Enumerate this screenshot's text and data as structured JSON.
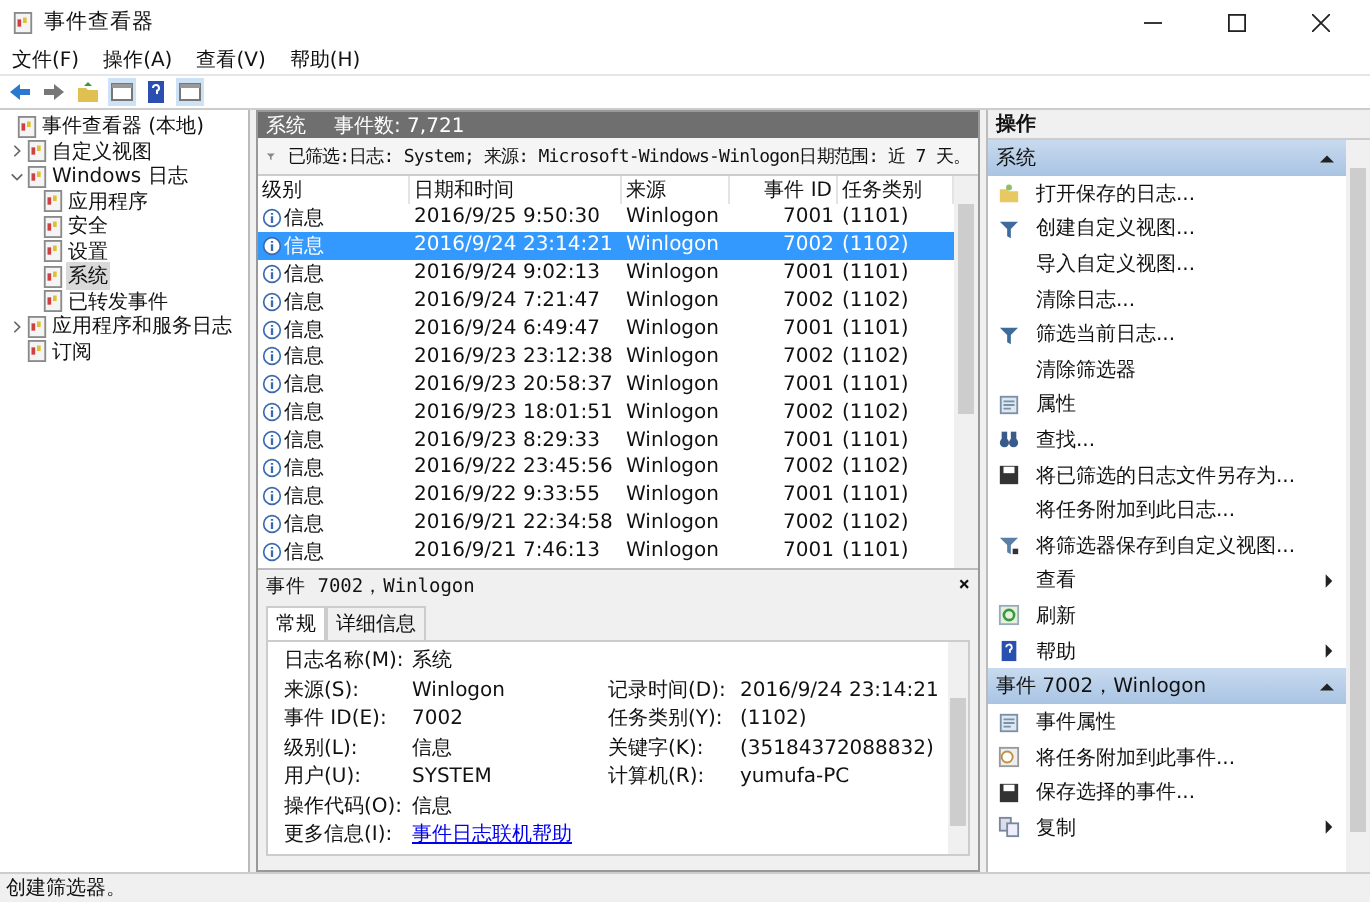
{
  "window": {
    "title": "事件查看器"
  },
  "menu": [
    "文件(F)",
    "操作(A)",
    "查看(V)",
    "帮助(H)"
  ],
  "tree": [
    {
      "label": "事件查看器 (本地)",
      "children": [
        {
          "label": "自定义视图",
          "expanded": false,
          "selected": false
        },
        {
          "label": "Windows 日志",
          "expanded": true,
          "selected": false,
          "children": [
            {
              "label": "应用程序",
              "selected": false
            },
            {
              "label": "安全",
              "selected": false
            },
            {
              "label": "设置",
              "selected": false
            },
            {
              "label": "系统",
              "selected": true
            },
            {
              "label": "已转发事件",
              "selected": false
            }
          ]
        },
        {
          "label": "应用程序和服务日志",
          "expanded": false,
          "selected": false
        },
        {
          "label": "订阅",
          "selected": false
        }
      ],
      "selected": false
    }
  ],
  "log_header": {
    "name": "系统",
    "count": "事件数: 7,721"
  },
  "filter": "已筛选:日志: System; 来源: Microsoft-Windows-Winlogon日期范围: 近 7 天。",
  "table": {
    "columns": [
      "级别",
      "日期和时间",
      "来源",
      "事件 ID",
      "任务类别"
    ],
    "rows": [
      {
        "level": "信息",
        "date": "2016/9/25 9:50:30",
        "source": "Winlogon",
        "id": "7001",
        "task": "(1101)",
        "selected": false
      },
      {
        "level": "信息",
        "date": "2016/9/24 23:14:21",
        "source": "Winlogon",
        "id": "7002",
        "task": "(1102)",
        "selected": true
      },
      {
        "level": "信息",
        "date": "2016/9/24 9:02:13",
        "source": "Winlogon",
        "id": "7001",
        "task": "(1101)",
        "selected": false
      },
      {
        "level": "信息",
        "date": "2016/9/24 7:21:47",
        "source": "Winlogon",
        "id": "7002",
        "task": "(1102)",
        "selected": false
      },
      {
        "level": "信息",
        "date": "2016/9/24 6:49:47",
        "source": "Winlogon",
        "id": "7001",
        "task": "(1101)",
        "selected": false
      },
      {
        "level": "信息",
        "date": "2016/9/23 23:12:38",
        "source": "Winlogon",
        "id": "7002",
        "task": "(1102)",
        "selected": false
      },
      {
        "level": "信息",
        "date": "2016/9/23 20:58:37",
        "source": "Winlogon",
        "id": "7001",
        "task": "(1101)",
        "selected": false
      },
      {
        "level": "信息",
        "date": "2016/9/23 18:01:51",
        "source": "Winlogon",
        "id": "7002",
        "task": "(1102)",
        "selected": false
      },
      {
        "level": "信息",
        "date": "2016/9/23 8:29:33",
        "source": "Winlogon",
        "id": "7001",
        "task": "(1101)",
        "selected": false
      },
      {
        "level": "信息",
        "date": "2016/9/22 23:45:56",
        "source": "Winlogon",
        "id": "7002",
        "task": "(1102)",
        "selected": false
      },
      {
        "level": "信息",
        "date": "2016/9/22 9:33:55",
        "source": "Winlogon",
        "id": "7001",
        "task": "(1101)",
        "selected": false
      },
      {
        "level": "信息",
        "date": "2016/9/21 22:34:58",
        "source": "Winlogon",
        "id": "7002",
        "task": "(1102)",
        "selected": false
      },
      {
        "level": "信息",
        "date": "2016/9/21 7:46:13",
        "source": "Winlogon",
        "id": "7001",
        "task": "(1101)",
        "selected": false
      }
    ]
  },
  "detail": {
    "title": "事件 7002，Winlogon",
    "close": "×",
    "tabs": [
      {
        "label": "常规",
        "selected": true
      },
      {
        "label": "详细信息",
        "selected": false
      }
    ],
    "rows": [
      [
        {
          "label": "日志名称(M):",
          "value": "系统"
        }
      ],
      [
        {
          "label": "来源(S):",
          "value": "Winlogon"
        },
        {
          "label": "记录时间(D):",
          "value": "2016/9/24 23:14:21"
        }
      ],
      [
        {
          "label": "事件 ID(E):",
          "value": "7002"
        },
        {
          "label": "任务类别(Y):",
          "value": "(1102)"
        }
      ],
      [
        {
          "label": "级别(L):",
          "value": "信息"
        },
        {
          "label": "关键字(K):",
          "value": "(35184372088832)"
        }
      ],
      [
        {
          "label": "用户(U):",
          "value": "SYSTEM"
        },
        {
          "label": "计算机(R):",
          "value": "yumufa-PC"
        }
      ],
      [
        {
          "label": "操作代码(O):",
          "value": "信息"
        }
      ],
      [
        {
          "label": "更多信息(I):",
          "value": "事件日志联机帮助",
          "kind": "link"
        }
      ]
    ]
  },
  "actions": {
    "title": "操作",
    "sections": [
      {
        "title": "系统",
        "expanded": true,
        "items": [
          {
            "label": "打开保存的日志...",
            "submenu": false
          },
          {
            "label": "创建自定义视图...",
            "submenu": false
          },
          {
            "label": "导入自定义视图...",
            "submenu": false
          },
          {
            "label": "清除日志...",
            "submenu": false
          },
          {
            "label": "筛选当前日志...",
            "submenu": false
          },
          {
            "label": "清除筛选器",
            "submenu": false
          },
          {
            "label": "属性",
            "submenu": false
          },
          {
            "label": "查找...",
            "submenu": false
          },
          {
            "label": "将已筛选的日志文件另存为...",
            "submenu": false
          },
          {
            "label": "将任务附加到此日志...",
            "submenu": false
          },
          {
            "label": "将筛选器保存到自定义视图...",
            "submenu": false
          },
          {
            "label": "查看",
            "submenu": true
          },
          {
            "label": "刷新",
            "submenu": false
          },
          {
            "label": "帮助",
            "submenu": true
          }
        ]
      },
      {
        "title": "事件 7002，Winlogon",
        "expanded": true,
        "items": [
          {
            "label": "事件属性",
            "submenu": false
          },
          {
            "label": "将任务附加到此事件...",
            "submenu": false
          },
          {
            "label": "保存选择的事件...",
            "submenu": false
          },
          {
            "label": "复制",
            "submenu": true
          }
        ]
      }
    ]
  },
  "status_bar": "创建筛选器。"
}
